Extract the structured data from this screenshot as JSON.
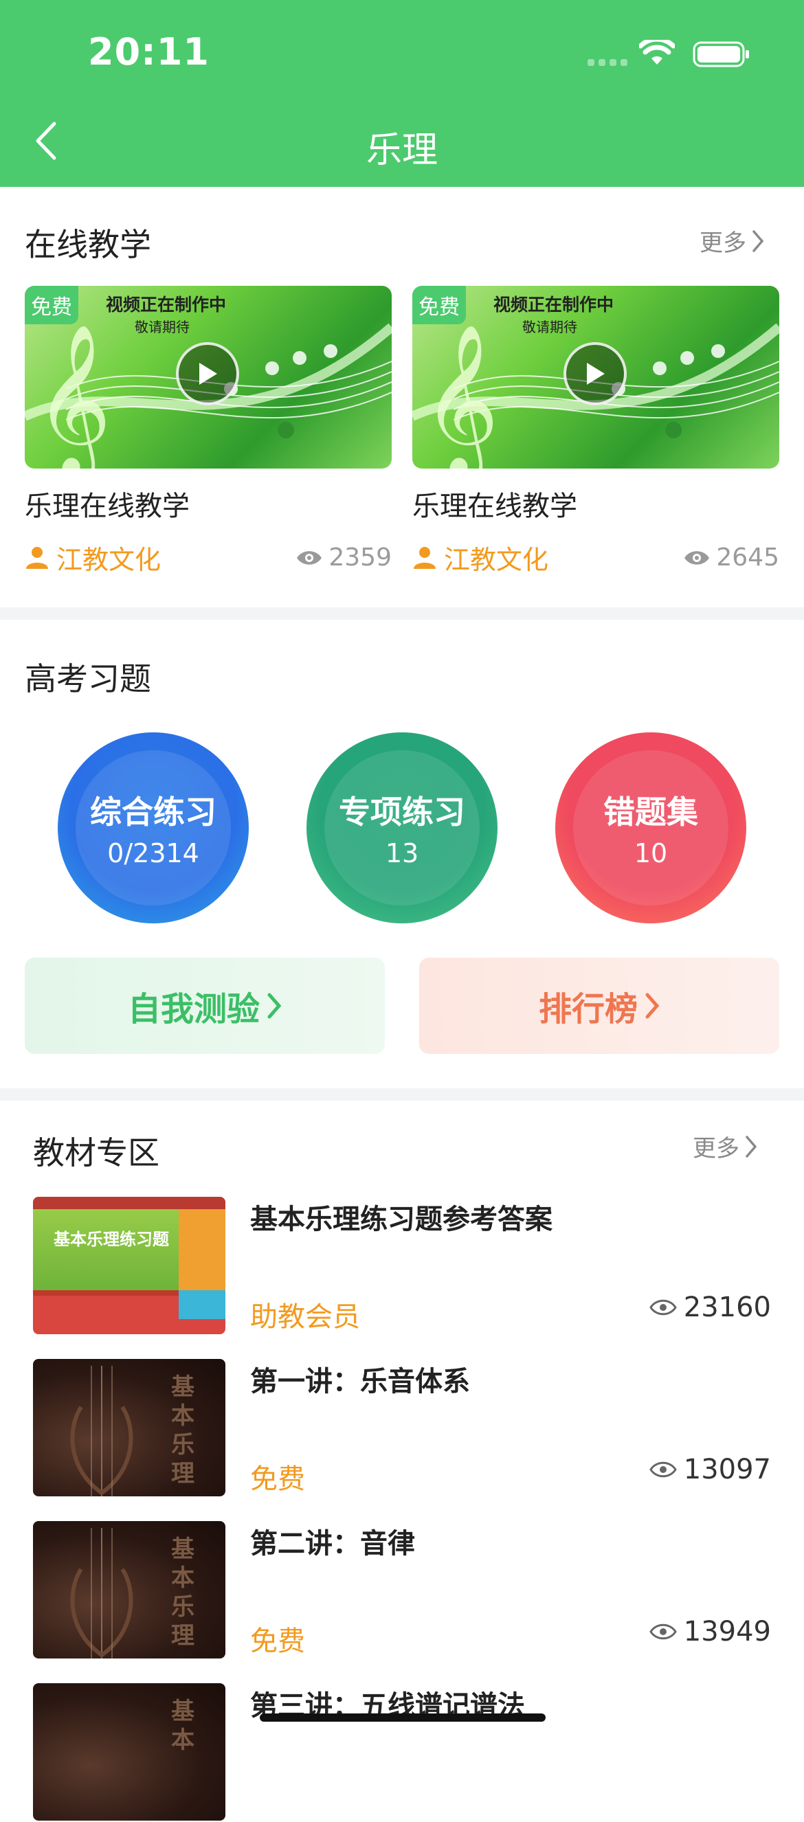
{
  "status_bar": {
    "time": "20:11"
  },
  "nav": {
    "title": "乐理"
  },
  "online_teaching": {
    "title": "在线教学",
    "more": "更多",
    "videos": [
      {
        "tag": "免费",
        "overlay_line1": "视频正在制作中",
        "overlay_line2": "敬请期待",
        "title": "乐理在线教学",
        "author": "江教文化",
        "views": "2359"
      },
      {
        "tag": "免费",
        "overlay_line1": "视频正在制作中",
        "overlay_line2": "敬请期待",
        "title": "乐理在线教学",
        "author": "江教文化",
        "views": "2645"
      }
    ]
  },
  "exam": {
    "title": "高考习题",
    "circles": [
      {
        "label": "综合练习",
        "value": "0/2314"
      },
      {
        "label": "专项练习",
        "value": "13"
      },
      {
        "label": "错题集",
        "value": "10"
      }
    ],
    "self_test": "自我测验",
    "ranking": "排行榜"
  },
  "textbooks": {
    "title": "教材专区",
    "more": "更多",
    "items": [
      {
        "title": "基本乐理练习题参考答案",
        "tag": "助教会员",
        "views": "23160",
        "cover_text": "基本乐理练习题"
      },
      {
        "title": "第一讲：乐音体系",
        "tag": "免费",
        "views": "13097",
        "cover_text": "基本乐理"
      },
      {
        "title": "第二讲：音律",
        "tag": "免费",
        "views": "13949",
        "cover_text": "基本乐理"
      },
      {
        "title": "第三讲：五线谱记谱法",
        "tag": "",
        "views": "",
        "cover_text": "基本"
      }
    ]
  },
  "colors": {
    "brand_green": "#4cca6e",
    "accent_orange": "#f29a1f",
    "rank_orange": "#ef7650"
  }
}
